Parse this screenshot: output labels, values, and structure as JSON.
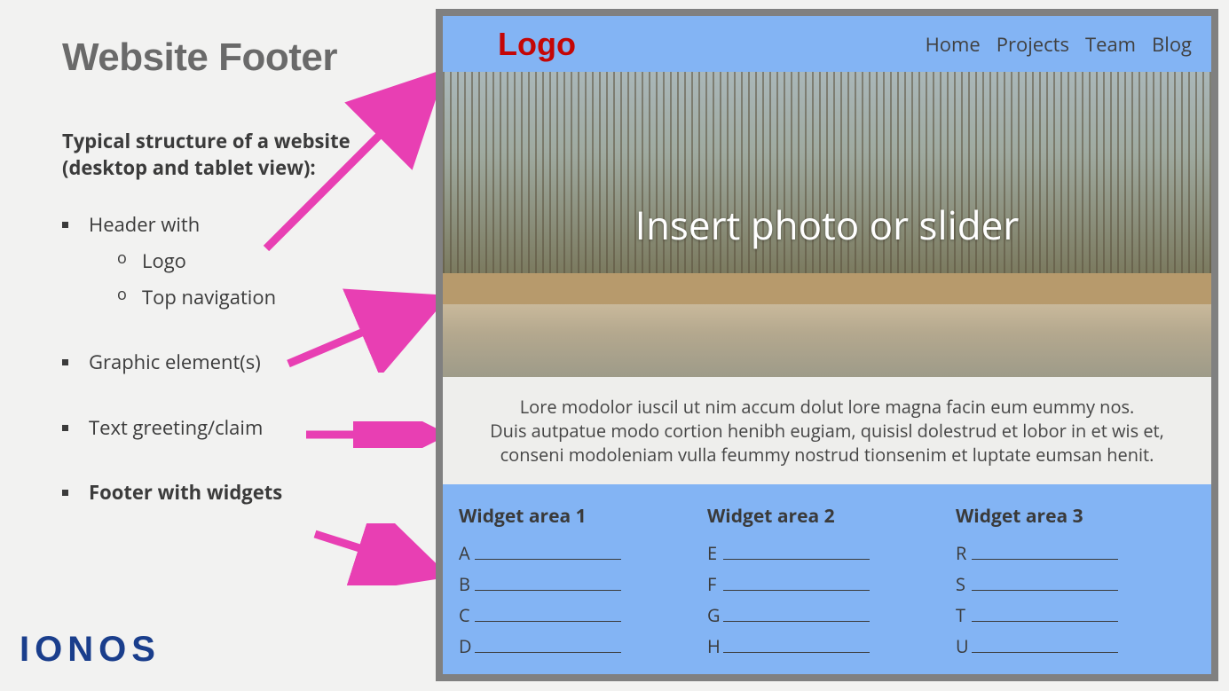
{
  "title": "Website Footer",
  "subtitle": "Typical structure of a website (desktop and tablet view):",
  "bullets": {
    "header": "Header with",
    "header_sub": [
      "Logo",
      "Top navigation"
    ],
    "graphic": "Graphic element(s)",
    "greeting": "Text greeting/claim",
    "footer": "Footer with widgets"
  },
  "brand": "IONOS",
  "mock": {
    "logo": "Logo",
    "nav": [
      "Home",
      "Projects",
      "Team",
      "Blog"
    ],
    "hero_text": "Insert photo or slider",
    "greeting_lines": [
      "Lore modolor iuscil ut nim accum dolut lore magna facin eum eummy nos.",
      "Duis autpatue modo cortion henibh eugiam, quisisl dolestrud et lobor in et wis et,",
      "conseni modoleniam vulla feummy nostrud tionsenim et luptate eumsan henit."
    ],
    "widgets": [
      {
        "title": "Widget area 1",
        "items": [
          "A",
          "B",
          "C",
          "D"
        ]
      },
      {
        "title": "Widget area 2",
        "items": [
          "E",
          "F",
          "G",
          "H"
        ]
      },
      {
        "title": "Widget area 3",
        "items": [
          "R",
          "S",
          "T",
          "U"
        ]
      }
    ]
  }
}
